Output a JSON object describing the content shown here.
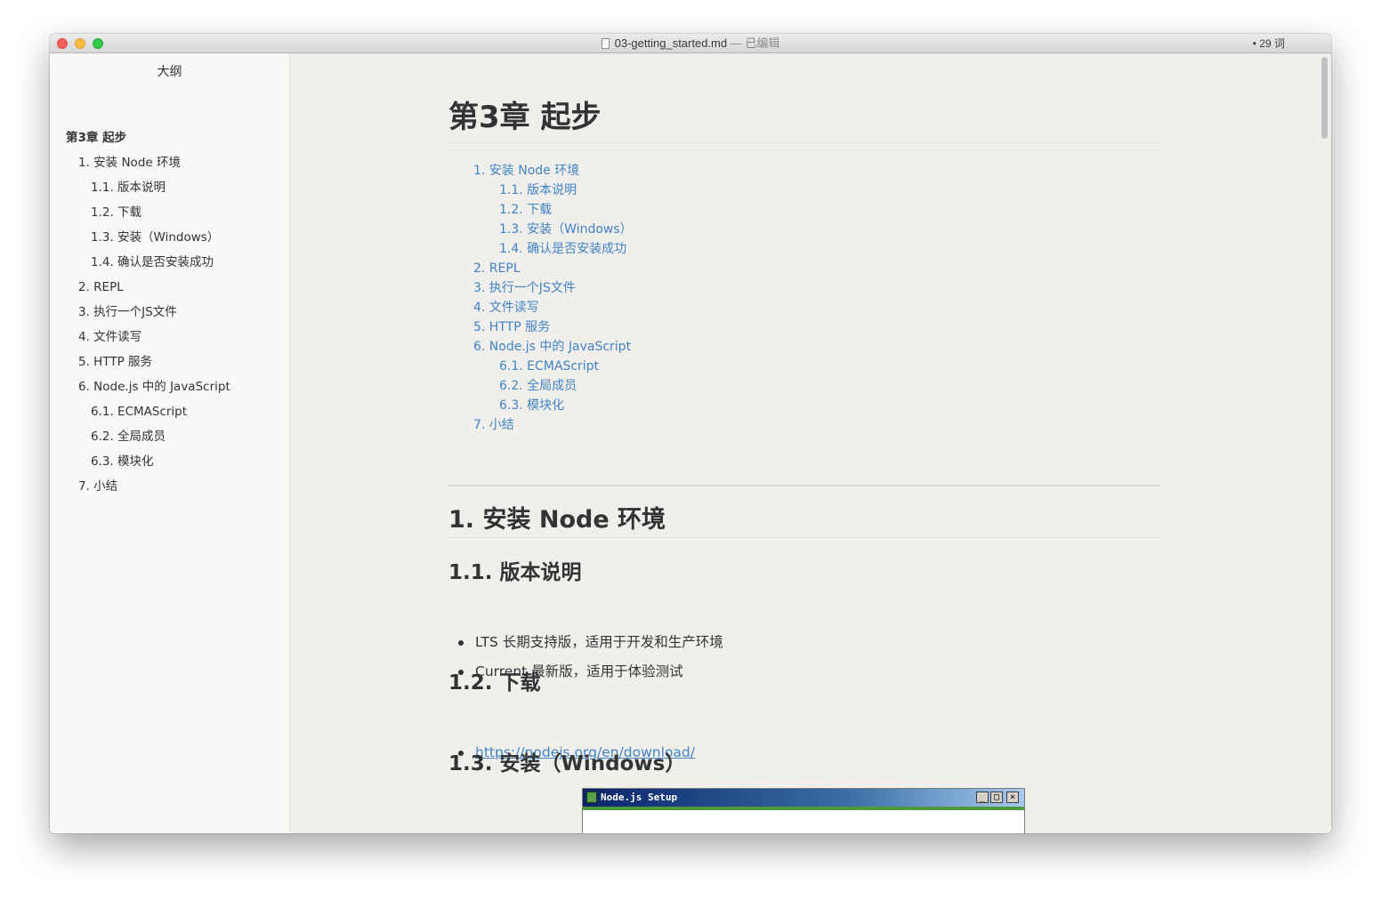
{
  "window": {
    "title": "03-getting_started.md",
    "edited": " — 已编辑",
    "word_count": "• 29 词"
  },
  "sidebar": {
    "title": "大纲",
    "items": [
      {
        "label": "第3章 起步"
      },
      {
        "label": "1. 安装 Node 环境"
      },
      {
        "label": "1.1. 版本说明"
      },
      {
        "label": "1.2. 下载"
      },
      {
        "label": "1.3. 安装（Windows）"
      },
      {
        "label": "1.4. 确认是否安装成功"
      },
      {
        "label": "2. REPL"
      },
      {
        "label": "3. 执行一个JS文件"
      },
      {
        "label": "4. 文件读写"
      },
      {
        "label": "5. HTTP 服务"
      },
      {
        "label": "6. Node.js 中的 JavaScript"
      },
      {
        "label": "6.1. ECMAScript"
      },
      {
        "label": "6.2. 全局成员"
      },
      {
        "label": "6.3. 模块化"
      },
      {
        "label": "7. 小结"
      }
    ]
  },
  "document": {
    "h1": "第3章 起步",
    "toc": [
      "1. 安装 Node 环境",
      "1.1. 版本说明",
      "1.2. 下载",
      "1.3. 安装（Windows）",
      "1.4. 确认是否安装成功",
      "2. REPL",
      "3. 执行一个JS文件",
      "4. 文件读写",
      "5. HTTP 服务",
      "6. Node.js 中的 JavaScript",
      "6.1. ECMAScript",
      "6.2. 全局成员",
      "6.3. 模块化",
      "7. 小结"
    ],
    "section1_title": "1. 安装 Node 环境",
    "sub11_title": "1.1. 版本说明",
    "sub11_items": [
      "LTS 长期支持版，适用于开发和生产环境",
      "Current 最新版，适用于体验测试"
    ],
    "sub12_title": "1.2. 下载",
    "download_link": "https://nodejs.org/en/download/",
    "sub13_title": "1.3. 安装（Windows）",
    "setup_window_title": "Node.js Setup",
    "setup_buttons": [
      "_",
      "□",
      "×"
    ]
  }
}
